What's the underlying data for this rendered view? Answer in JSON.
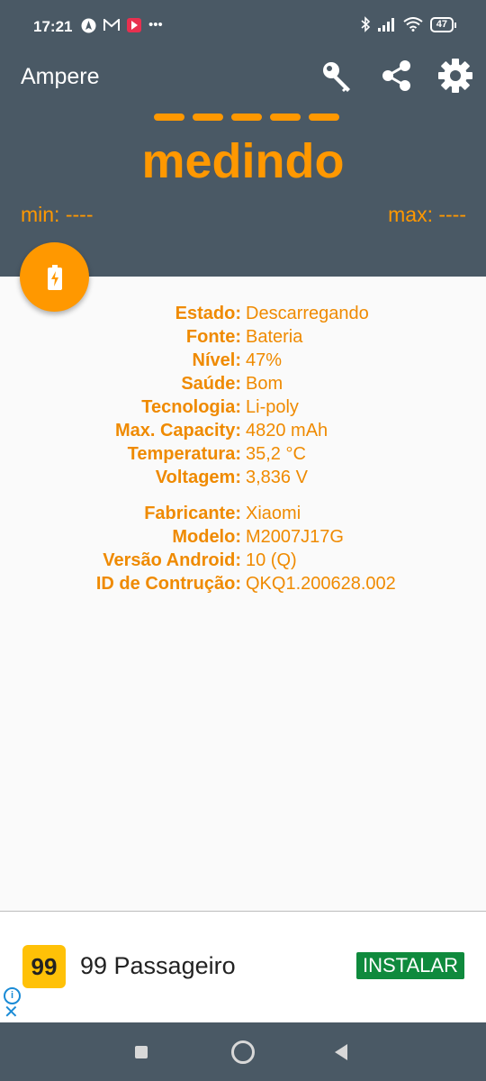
{
  "status_bar": {
    "time": "17:21",
    "battery_level": "47",
    "left_icons": [
      "navigation-icon",
      "gmail-icon",
      "media-icon",
      "more-dots-icon"
    ],
    "right_icons": [
      "bluetooth-icon",
      "signal-icon",
      "wifi-icon",
      "battery-icon"
    ]
  },
  "header": {
    "title": "Ampere",
    "status": "medindo",
    "min_label": "min: ----",
    "max_label": "max: ----",
    "accent_color": "#ff9800",
    "background_color": "#4a5965",
    "icons": [
      "key-icon",
      "share-icon",
      "gear-icon"
    ]
  },
  "fab": {
    "icon": "battery-charging-icon"
  },
  "battery_info": [
    {
      "key": "Estado:",
      "value": "Descarregando"
    },
    {
      "key": "Fonte:",
      "value": "Bateria"
    },
    {
      "key": "Nível:",
      "value": "47%"
    },
    {
      "key": "Saúde:",
      "value": "Bom"
    },
    {
      "key": "Tecnologia:",
      "value": "Li-poly"
    },
    {
      "key": "Max. Capacity:",
      "value": "4820 mAh"
    },
    {
      "key": "Temperatura:",
      "value": "35,2 °C"
    },
    {
      "key": "Voltagem:",
      "value": "3,836 V"
    }
  ],
  "device_info": [
    {
      "key": "Fabricante:",
      "value": "Xiaomi"
    },
    {
      "key": "Modelo:",
      "value": "M2007J17G"
    },
    {
      "key": "Versão Android:",
      "value": "10 (Q)"
    },
    {
      "key": "ID de Contrução:",
      "value": "QKQ1.200628.002"
    }
  ],
  "ad": {
    "logo_text": "99",
    "name": "99 Passageiro",
    "install_label": "INSTALAR",
    "info_glyph": "i",
    "close_glyph": "✕"
  }
}
